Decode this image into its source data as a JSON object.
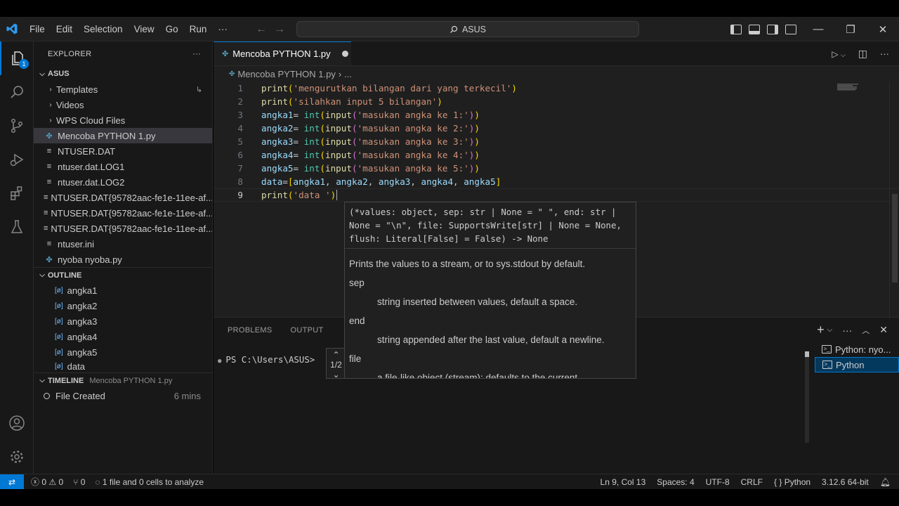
{
  "titlebar": {
    "menu": [
      "File",
      "Edit",
      "Selection",
      "View",
      "Go",
      "Run",
      "···"
    ],
    "search_text": "ASUS",
    "back": "←",
    "forward": "→"
  },
  "sidebar": {
    "header": "EXPLORER",
    "more": "···",
    "root": "ASUS",
    "folders": [
      "Templates",
      "Videos",
      "WPS Cloud Files"
    ],
    "files": [
      {
        "name": "Mencoba PYTHON 1.py",
        "type": "py",
        "selected": true
      },
      {
        "name": "NTUSER.DAT",
        "type": "txt"
      },
      {
        "name": "ntuser.dat.LOG1",
        "type": "txt"
      },
      {
        "name": "ntuser.dat.LOG2",
        "type": "txt"
      },
      {
        "name": "NTUSER.DAT{95782aac-fe1e-11ee-af...",
        "type": "txt"
      },
      {
        "name": "NTUSER.DAT{95782aac-fe1e-11ee-af...",
        "type": "txt"
      },
      {
        "name": "NTUSER.DAT{95782aac-fe1e-11ee-af...",
        "type": "txt"
      },
      {
        "name": "ntuser.ini",
        "type": "txt"
      },
      {
        "name": "nyoba nyoba.py",
        "type": "py"
      }
    ],
    "outline_title": "OUTLINE",
    "outline": [
      "angka1",
      "angka2",
      "angka3",
      "angka4",
      "angka5",
      "data"
    ],
    "timeline_title": "TIMELINE",
    "timeline_file": "Mencoba PYTHON 1.py",
    "timeline_entry": "File Created",
    "timeline_time": "6 mins"
  },
  "activity": {
    "badge": "1"
  },
  "editor": {
    "tab_label": "Mencoba PYTHON 1.py",
    "breadcrumb_file": "Mencoba PYTHON 1.py",
    "breadcrumb_more": "...",
    "active_line": 9,
    "lines": [
      "print('mengurutkan bilangan dari yang terkecil')",
      "print('silahkan input 5 bilangan')",
      "angka1= int(input('masukan angka ke 1:'))",
      "angka2= int(input('masukan angka ke 2:'))",
      "angka3= int(input('masukan angka ke 3:'))",
      "angka4= int(input('masukan angka ke 4:'))",
      "angka5= int(input('masukan angka ke 5:'))",
      "data=[angka1, angka2, angka3, angka4, angka5]",
      "print('data ')"
    ]
  },
  "hover": {
    "signature_1": "(*values: object, sep: str | None = \" \", end: str |",
    "signature_2": "None = \"\\n\", file: SupportsWrite[str] | None = None,",
    "signature_3": "flush: Literal[False] = False) -> None",
    "doc_summary": "Prints the values to a stream, or to sys.stdout by default.",
    "param_sep": "sep",
    "param_sep_desc": "string inserted between values, default a space.",
    "param_end": "end",
    "param_end_desc": "string appended after the last value, default a newline.",
    "param_file": "file",
    "param_file_desc": "a file-like object (stream); defaults to the current",
    "overload": "1/2"
  },
  "panel": {
    "tabs": [
      "PROBLEMS",
      "OUTPUT"
    ],
    "terminal_prompt": "PS C:\\Users\\ASUS>",
    "terminals": [
      "Python: nyo...",
      "Python"
    ]
  },
  "statusbar": {
    "errors": "0",
    "warnings": "0",
    "ports": "0",
    "analysis": "1 file and 0 cells to analyze",
    "position": "Ln 9, Col 13",
    "spaces": "Spaces: 4",
    "encoding": "UTF-8",
    "eol": "CRLF",
    "language": "Python",
    "interpreter": "3.12.6 64-bit"
  },
  "colors": {
    "accent": "#0078d4",
    "editor_bg": "#1f1f1f",
    "sidebar_bg": "#181818"
  }
}
